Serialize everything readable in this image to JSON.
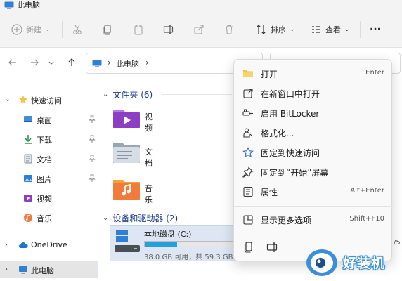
{
  "window": {
    "title": "此电脑"
  },
  "toolbar": {
    "new_label": "新建",
    "sort_label": "排序",
    "view_label": "查看",
    "more_label": "···"
  },
  "address": {
    "crumb": "此电脑"
  },
  "sidebar": {
    "items": [
      {
        "label": "快速访问",
        "icon": "star-icon"
      },
      {
        "label": "桌面",
        "icon": "desktop-icon"
      },
      {
        "label": "下载",
        "icon": "download-icon"
      },
      {
        "label": "文档",
        "icon": "document-icon"
      },
      {
        "label": "图片",
        "icon": "picture-icon"
      },
      {
        "label": "视频",
        "icon": "video-icon"
      },
      {
        "label": "音乐",
        "icon": "music-icon"
      },
      {
        "label": "OneDrive",
        "icon": "cloud-icon"
      },
      {
        "label": "此电脑",
        "icon": "computer-icon"
      }
    ]
  },
  "main": {
    "folders_header": "文件夹 (6)",
    "folders": [
      {
        "name": "视频"
      },
      {
        "name": "文档"
      },
      {
        "name": "音乐"
      }
    ],
    "devices_header": "设备和驱动器 (2)",
    "drive": {
      "name": "本地磁盘 (C:)",
      "size_text": "38.0 GB 可用，共 59.3 GB",
      "used_fraction": 0.36
    },
    "right_peek": "/5"
  },
  "context_menu": {
    "items": [
      {
        "label": "打开",
        "shortcut": "Enter",
        "icon": "open-folder-icon"
      },
      {
        "label": "在新窗口中打开",
        "shortcut": "",
        "icon": "new-window-icon"
      },
      {
        "label": "启用 BitLocker",
        "shortcut": "",
        "icon": "key-icon"
      },
      {
        "label": "格式化...",
        "shortcut": "",
        "icon": "format-icon"
      },
      {
        "label": "固定到快速访问",
        "shortcut": "",
        "icon": "star-outline-icon"
      },
      {
        "label": "固定到“开始”屏幕",
        "shortcut": "",
        "icon": "pin-icon"
      },
      {
        "label": "属性",
        "shortcut": "Alt+Enter",
        "icon": "properties-icon"
      },
      {
        "label": "显示更多选项",
        "shortcut": "Shift+F10",
        "icon": "more-options-icon"
      }
    ]
  },
  "watermark": {
    "text": "好装机"
  },
  "colors": {
    "accent": "#26a0da",
    "folder_yellow": "#f4c542",
    "selection": "#e5e5e5",
    "group_header": "#1f3a8a"
  }
}
